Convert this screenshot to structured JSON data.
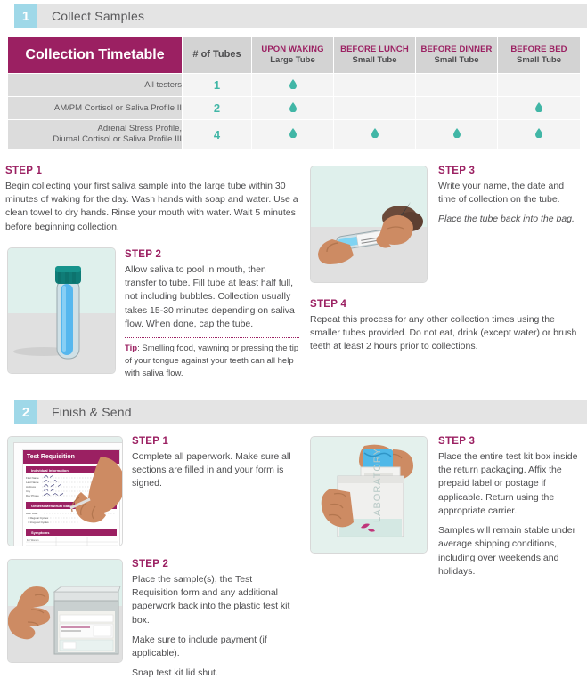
{
  "sections": [
    {
      "number": "1",
      "title": "Collect Samples"
    },
    {
      "number": "2",
      "title": "Finish & Send"
    }
  ],
  "colors": {
    "brand_magenta": "#9b2062",
    "accent_teal": "#41b6a6",
    "section_number_bg": "#9fd8e8",
    "section_bar_bg": "#e4e4e4",
    "body_text": "#4d4d4f"
  },
  "timetable": {
    "title": "Collection Timetable",
    "columns": [
      {
        "top": "",
        "bottom": "# of Tubes",
        "style": "plain"
      },
      {
        "top": "UPON WAKING",
        "bottom": "Large Tube",
        "style": "two-line"
      },
      {
        "top": "BEFORE LUNCH",
        "bottom": "Small Tube",
        "style": "two-line"
      },
      {
        "top": "BEFORE DINNER",
        "bottom": "Small Tube",
        "style": "two-line"
      },
      {
        "top": "BEFORE BED",
        "bottom": "Small Tube",
        "style": "two-line"
      }
    ],
    "rows": [
      {
        "label": "All testers",
        "label_line2": "",
        "tubes": "1",
        "marks": [
          true,
          false,
          false,
          false
        ]
      },
      {
        "label": "AM/PM Cortisol or Saliva Profile II",
        "label_line2": "",
        "tubes": "2",
        "marks": [
          true,
          false,
          false,
          true
        ]
      },
      {
        "label": "Adrenal Stress Profile,",
        "label_line2": "Diurnal Cortisol or Saliva Profile III",
        "tubes": "4",
        "marks": [
          true,
          true,
          true,
          true
        ]
      }
    ],
    "mark_icon": "saliva-drop-icon"
  },
  "collect": {
    "step1": {
      "heading": "STEP 1",
      "body": "Begin collecting your first saliva sample into the large tube within 30 minutes of waking for the day. Wash hands with soap and water. Use a clean towel to dry hands. Rinse your mouth with water. Wait 5 minutes before beginning collection."
    },
    "step2": {
      "heading": "STEP 2",
      "body": "Allow saliva to pool in mouth, then transfer to tube. Fill tube at least half full, not including bubbles. Collection usually takes 15-30 minutes depending on saliva flow. When done, cap the tube.",
      "tip_label": "Tip",
      "tip_body": ": Smelling food, yawning or pressing the tip of your tongue against your teeth can all help with saliva flow.",
      "image_alt": "saliva-collection-tube-photo"
    },
    "step3": {
      "heading": "STEP 3",
      "body": "Write your name, the date and time of collection on the tube.",
      "note": "Place the tube back into the bag.",
      "image_alt": "labeling-tube-photo"
    },
    "step4": {
      "heading": "STEP 4",
      "body": "Repeat this process for any other collection times using the smaller tubes provided. Do not eat, drink (except water) or brush teeth at least 2 hours prior to collections."
    }
  },
  "finish": {
    "step1": {
      "heading": "STEP 1",
      "body": "Complete all paperwork. Make sure all sections are filled in and your form is signed.",
      "image_alt": "test-requisition-form-photo",
      "form_title": "Test Requisition",
      "form_sections": [
        "Individual Information",
        "General/Menstrual Status - Female",
        "Symptoms"
      ]
    },
    "step2": {
      "heading": "STEP 2",
      "body": "Place the sample(s), the Test Requisition form and any additional paperwork back into the plastic test kit box.",
      "body2": "Make sure to include payment (if applicable).",
      "body3": "Snap test kit lid shut.",
      "image_alt": "test-kit-box-photo"
    },
    "step3": {
      "heading": "STEP 3",
      "body": "Place the entire test kit box inside the return packaging. Affix the prepaid label or postage if applicable. Return using the appropriate carrier.",
      "body2": "Samples will remain stable under average shipping conditions, including over weekends and holidays.",
      "image_alt": "return-packaging-photo",
      "package_text": "LABORATORY"
    }
  }
}
